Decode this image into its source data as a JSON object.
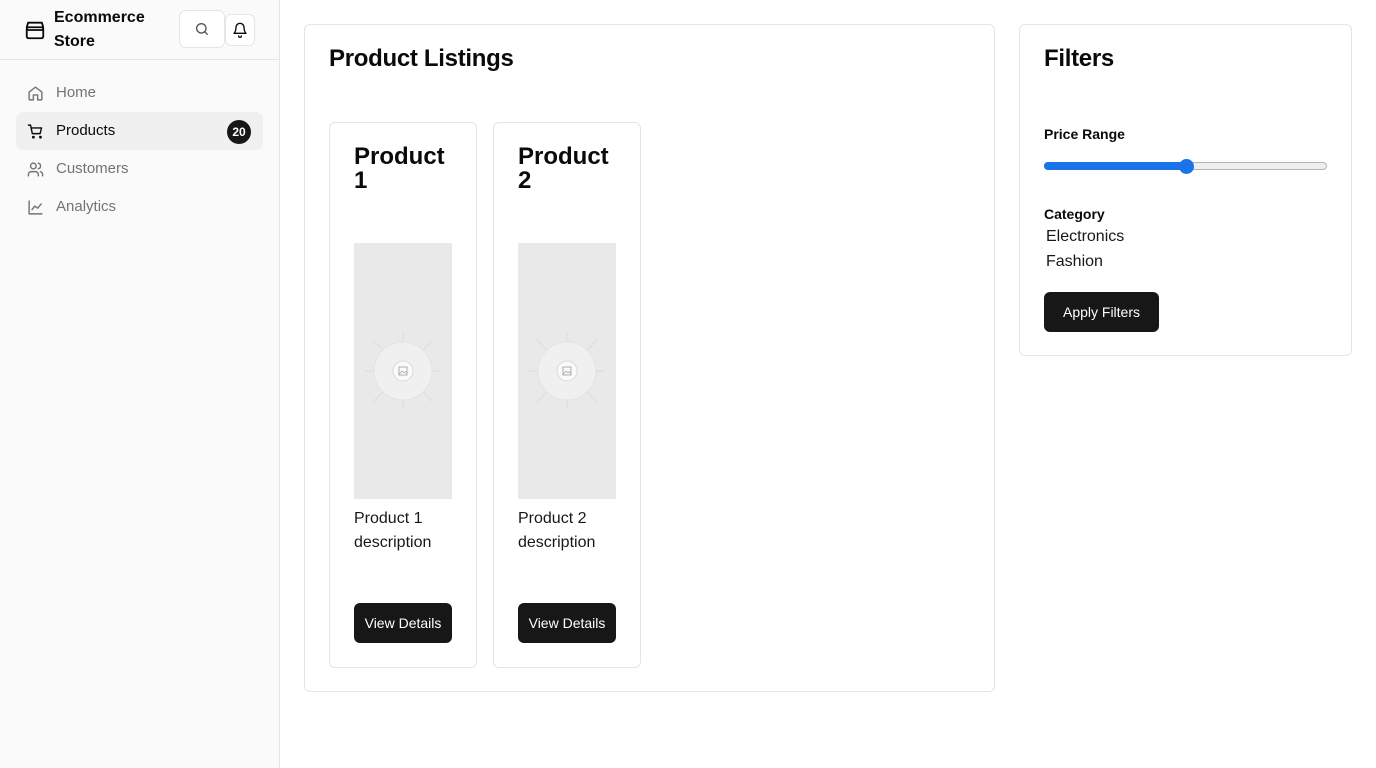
{
  "sidebar": {
    "brand": "Ecommerce Store",
    "nav": [
      {
        "label": "Home",
        "icon": "home-icon"
      },
      {
        "label": "Products",
        "icon": "cart-icon",
        "badge": "20",
        "active": true
      },
      {
        "label": "Customers",
        "icon": "users-icon"
      },
      {
        "label": "Analytics",
        "icon": "chart-line-icon"
      }
    ]
  },
  "main": {
    "title": "Product Listings",
    "products": [
      {
        "name": "Product 1",
        "description": "Product 1 description",
        "button": "View Details"
      },
      {
        "name": "Product 2",
        "description": "Product 2 description",
        "button": "View Details"
      }
    ]
  },
  "filters": {
    "title": "Filters",
    "price_label": "Price Range",
    "price_value": 0.5,
    "category_label": "Category",
    "categories": [
      "Electronics",
      "Fashion"
    ],
    "apply_label": "Apply Filters"
  },
  "colors": {
    "accent": "#1a73e8",
    "button": "#171717",
    "sidebar_bg": "#fafafa"
  }
}
